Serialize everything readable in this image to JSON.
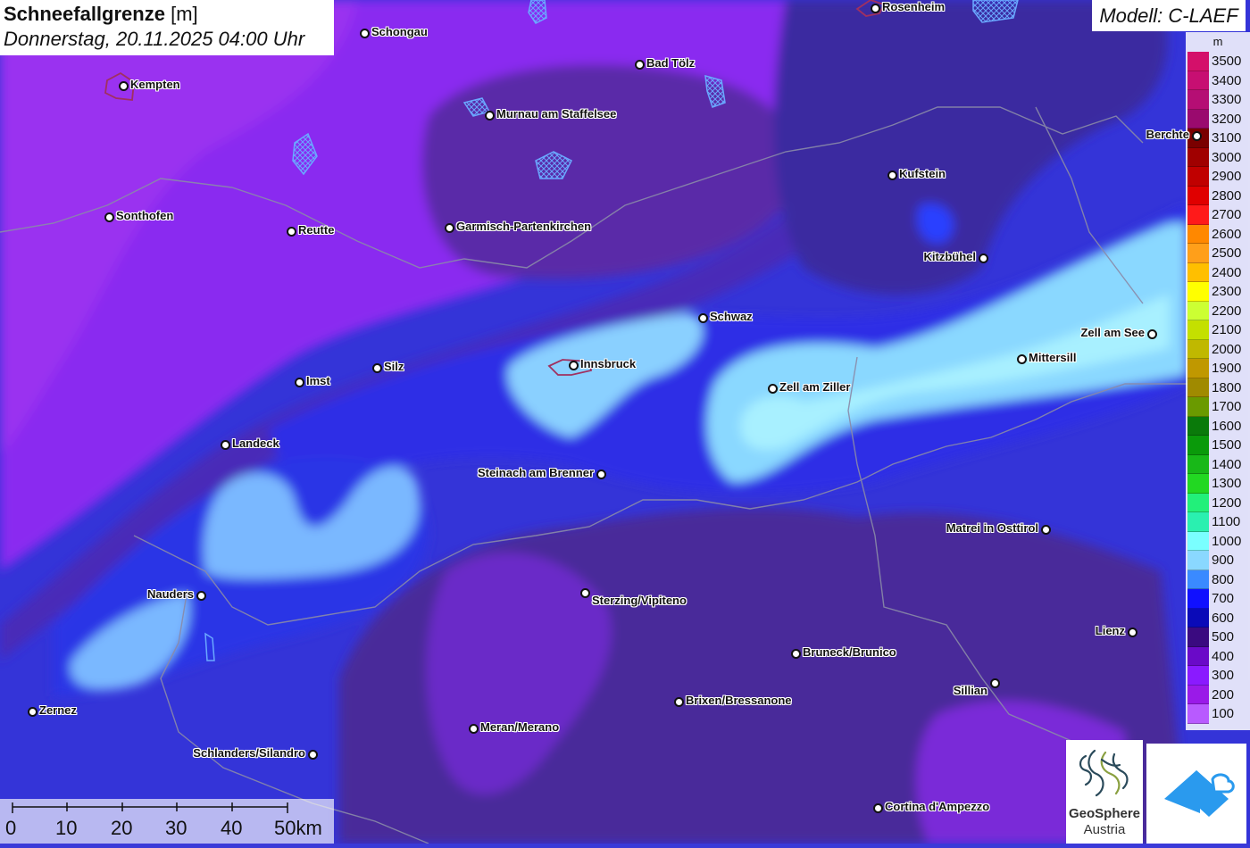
{
  "header": {
    "title_bold": "Schneefallgrenze",
    "title_unit": "[m]",
    "datetime": "Donnerstag, 20.11.2025 04:00 Uhr",
    "model": "Modell: C-LAEF"
  },
  "legend": {
    "unit": "m",
    "items": [
      {
        "value": "3500",
        "color": "#d4106a"
      },
      {
        "value": "3400",
        "color": "#c70f72"
      },
      {
        "value": "3300",
        "color": "#b50e74"
      },
      {
        "value": "3200",
        "color": "#9a0a6e"
      },
      {
        "value": "3100",
        "color": "#7a0000"
      },
      {
        "value": "3000",
        "color": "#a00000"
      },
      {
        "value": "2900",
        "color": "#c00000"
      },
      {
        "value": "2800",
        "color": "#e00000"
      },
      {
        "value": "2700",
        "color": "#ff1a1a"
      },
      {
        "value": "2600",
        "color": "#ff8800"
      },
      {
        "value": "2500",
        "color": "#ff9f1a"
      },
      {
        "value": "2400",
        "color": "#ffbf00"
      },
      {
        "value": "2300",
        "color": "#ffff00"
      },
      {
        "value": "2200",
        "color": "#ccff33"
      },
      {
        "value": "2100",
        "color": "#c4e000"
      },
      {
        "value": "2000",
        "color": "#c0b800"
      },
      {
        "value": "1900",
        "color": "#c09800"
      },
      {
        "value": "1800",
        "color": "#a08a00"
      },
      {
        "value": "1700",
        "color": "#6a9a00"
      },
      {
        "value": "1600",
        "color": "#0a7a0a"
      },
      {
        "value": "1500",
        "color": "#0a9a0a"
      },
      {
        "value": "1400",
        "color": "#18b818"
      },
      {
        "value": "1300",
        "color": "#22d822"
      },
      {
        "value": "1200",
        "color": "#22f07a"
      },
      {
        "value": "1100",
        "color": "#2af0b0"
      },
      {
        "value": "1000",
        "color": "#7affff"
      },
      {
        "value": "900",
        "color": "#8ad8ff"
      },
      {
        "value": "800",
        "color": "#3a8aff"
      },
      {
        "value": "700",
        "color": "#1010ff"
      },
      {
        "value": "600",
        "color": "#0a0ab8"
      },
      {
        "value": "500",
        "color": "#3a0a80"
      },
      {
        "value": "400",
        "color": "#6a0ac8"
      },
      {
        "value": "300",
        "color": "#8a1aff"
      },
      {
        "value": "200",
        "color": "#9a1ae8"
      },
      {
        "value": "100",
        "color": "#b85aff"
      }
    ]
  },
  "cities": [
    {
      "name": "Rosenheim"
    },
    {
      "name": "Schongau"
    },
    {
      "name": "Bad Tölz"
    },
    {
      "name": "Kempten"
    },
    {
      "name": "Murnau am Staffelsee"
    },
    {
      "name": "Berchte"
    },
    {
      "name": "Kufstein"
    },
    {
      "name": "Sonthofen"
    },
    {
      "name": "Reutte"
    },
    {
      "name": "Garmisch-Partenkirchen"
    },
    {
      "name": "Kitzbühel"
    },
    {
      "name": "Schwaz"
    },
    {
      "name": "Zell am See"
    },
    {
      "name": "Mittersill"
    },
    {
      "name": "Innsbruck"
    },
    {
      "name": "Silz"
    },
    {
      "name": "Imst"
    },
    {
      "name": "Zell am Ziller"
    },
    {
      "name": "Landeck"
    },
    {
      "name": "Steinach am Brenner"
    },
    {
      "name": "Matrei in Osttirol"
    },
    {
      "name": "Nauders"
    },
    {
      "name": "Sterzing/Vipiteno"
    },
    {
      "name": "Lienz"
    },
    {
      "name": "Bruneck/Brunico"
    },
    {
      "name": "Sillian"
    },
    {
      "name": "Brixen/Bressanone"
    },
    {
      "name": "Zernez"
    },
    {
      "name": "Meran/Merano"
    },
    {
      "name": "Schlanders/Silandro"
    },
    {
      "name": "Cortina d'Ampezzo"
    }
  ],
  "scalebar": {
    "labels": [
      "0",
      "10",
      "20",
      "30",
      "40",
      "50km"
    ]
  },
  "logos": {
    "geosphere_line1": "GeoSphere",
    "geosphere_line2": "Austria"
  },
  "colors": {
    "deep_purple": "#5a2aa8",
    "purple": "#8a2af0",
    "blue": "#2e2ee0",
    "light_blue": "#7ab6ff",
    "cyan": "#9ae8ff"
  }
}
